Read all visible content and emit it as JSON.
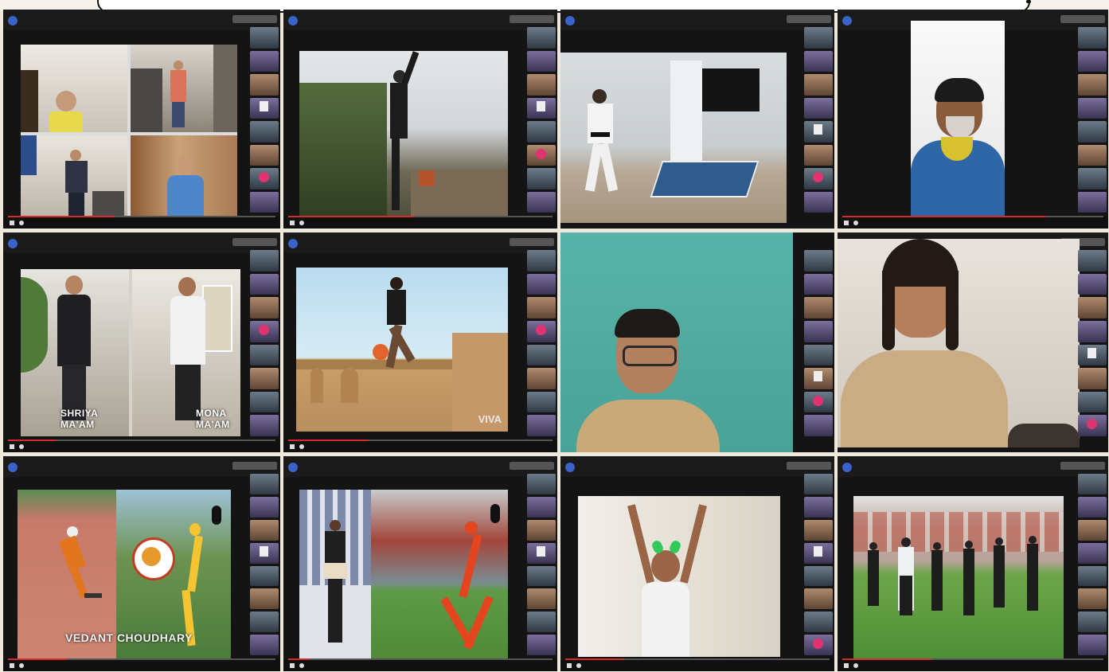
{
  "captions": {
    "shriya": "SHRIYA MA'AM",
    "mona": "MONA MA'AM",
    "vedant": "VEDANT CHOUDHARY",
    "viva": "VIVA"
  },
  "colors": {
    "frame_bg": "#141414",
    "progress": "#d52b2b",
    "avatar_pink": "#e0336f",
    "page_bg": "#efe8dc"
  }
}
